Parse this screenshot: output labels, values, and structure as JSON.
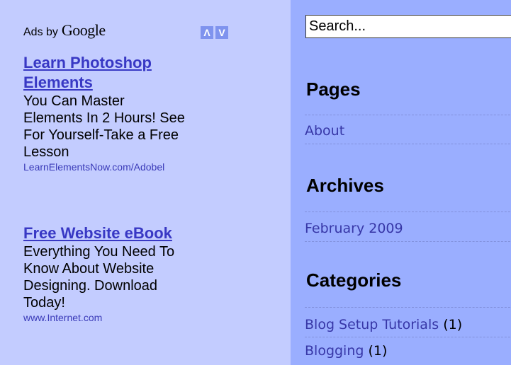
{
  "ads": {
    "ads_by": "Ads by",
    "google": "Google",
    "prev_arrow": "Λ",
    "next_arrow": "V",
    "items": [
      {
        "title_line1": "Learn Photoshop",
        "title_line2": "Elements",
        "body": [
          "You Can Master",
          "Elements In 2 Hours! See",
          "For Yourself-Take a Free",
          "Lesson"
        ],
        "url": "LearnElementsNow.com/Adobel"
      },
      {
        "title_line1": "Free Website eBook",
        "body": [
          "Everything You Need To",
          "Know About Website",
          "Designing. Download",
          "Today!"
        ],
        "url": "www.Internet.com"
      }
    ]
  },
  "sidebar": {
    "search_placeholder": "Search...",
    "pages": {
      "title": "Pages",
      "items": [
        "About"
      ]
    },
    "archives": {
      "title": "Archives",
      "items": [
        "February 2009"
      ]
    },
    "categories": {
      "title": "Categories",
      "items": [
        {
          "label": "Blog Setup Tutorials",
          "count": "(1)"
        },
        {
          "label": "Blogging",
          "count": "(1)"
        }
      ]
    }
  },
  "colors": {
    "ads_background": "#c3ccff",
    "sidebar_background": "#9aaeff",
    "ad_title": "#3838c4",
    "sidebar_link": "#3737a7",
    "arrow_button": "#7f93ee"
  }
}
